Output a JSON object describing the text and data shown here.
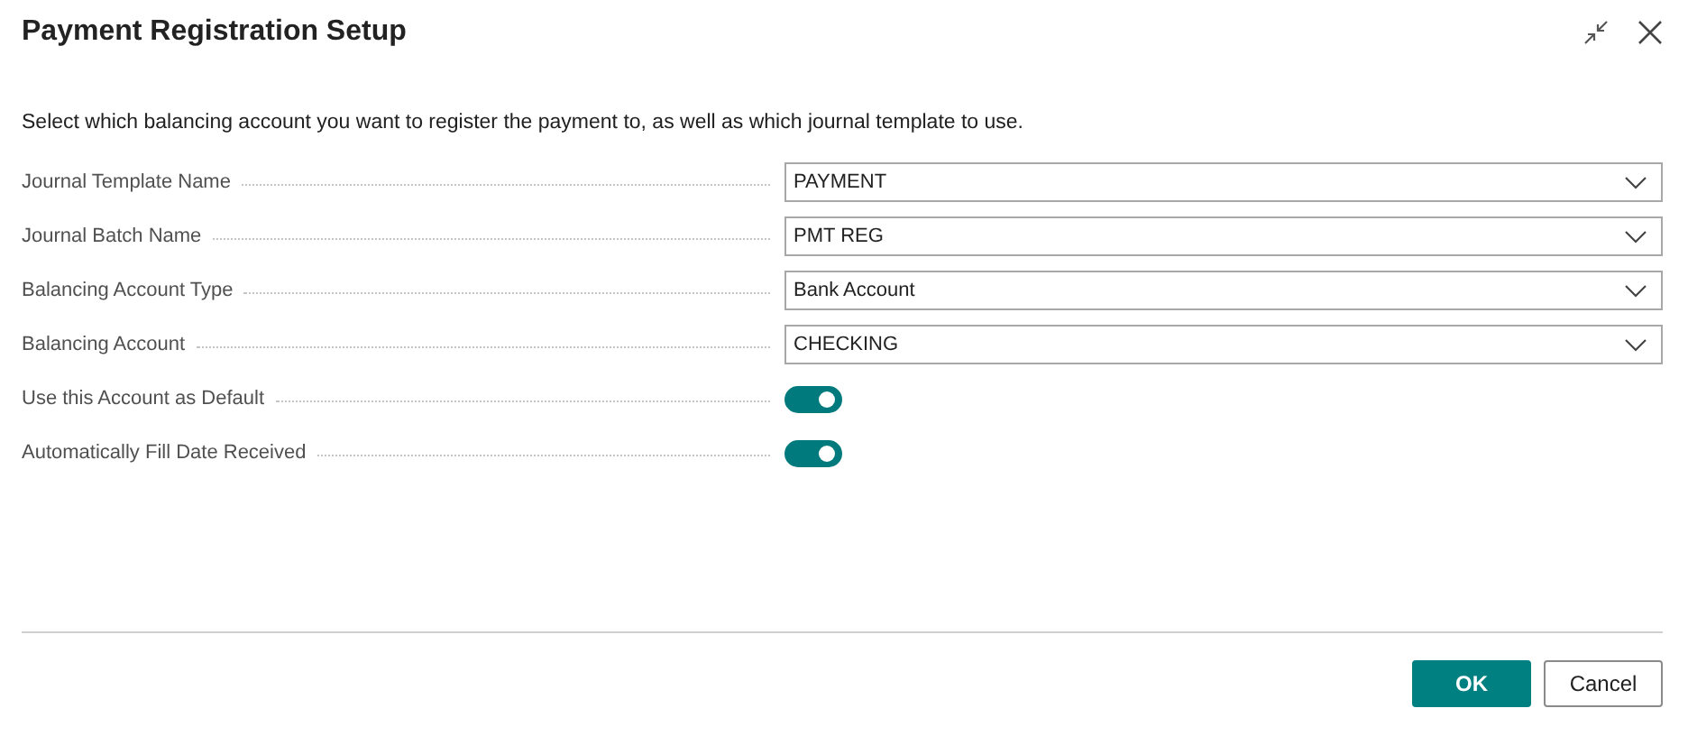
{
  "dialog": {
    "title": "Payment Registration Setup"
  },
  "description": "Select which balancing account you want to register the payment to, as well as which journal template to use.",
  "fields": [
    {
      "kind": "dropdown",
      "label": "Journal Template Name",
      "value": "PAYMENT"
    },
    {
      "kind": "dropdown",
      "label": "Journal Batch Name",
      "value": "PMT REG"
    },
    {
      "kind": "dropdown",
      "label": "Balancing Account Type",
      "value": "Bank Account"
    },
    {
      "kind": "dropdown",
      "label": "Balancing Account",
      "value": "CHECKING"
    },
    {
      "kind": "toggle",
      "label": "Use this Account as Default",
      "on": true
    },
    {
      "kind": "toggle",
      "label": "Automatically Fill Date Received",
      "on": true
    }
  ],
  "buttons": [
    {
      "label": "OK",
      "kind": "primary"
    },
    {
      "label": "Cancel",
      "kind": "secondary"
    }
  ]
}
